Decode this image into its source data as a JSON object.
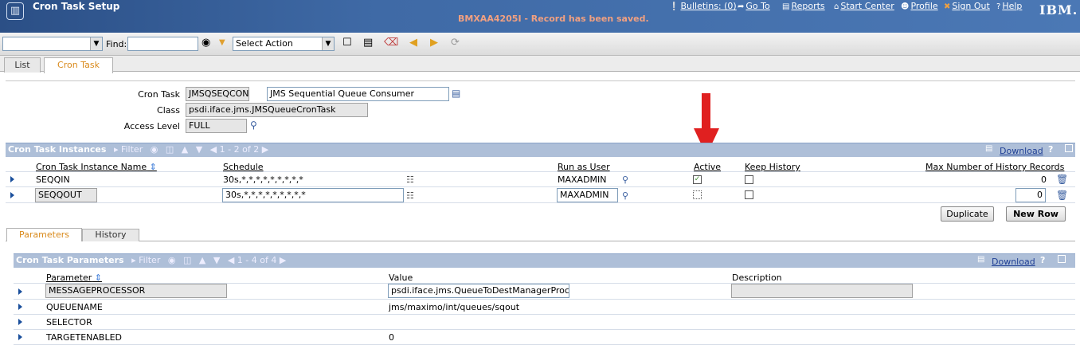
{
  "header": {
    "app_title": "Cron Task Setup",
    "message": "BMXAA4205I - Record has been saved.",
    "links": {
      "bulletins": "Bulletins: (0)",
      "goto": "Go To",
      "reports": "Reports",
      "start_center": "Start Center",
      "profile": "Profile",
      "sign_out": "Sign Out",
      "help": "Help"
    },
    "brand": "IBM."
  },
  "toolbar": {
    "find_label": "Find:",
    "find_value": "",
    "query_value": "",
    "action_value": "Select Action"
  },
  "tabs": {
    "list": "List",
    "cron_task": "Cron Task"
  },
  "form": {
    "cron_task_label": "Cron Task",
    "cron_task_value": "JMSQSEQCONS",
    "description_value": "JMS Sequential Queue Consumer",
    "class_label": "Class",
    "class_value": "psdi.iface.jms.JMSQueueCronTask",
    "access_label": "Access Level",
    "access_value": "FULL"
  },
  "instances": {
    "title": "Cron Task Instances",
    "filter": "Filter",
    "count": "1 - 2 of 2",
    "download": "Download",
    "help": "?",
    "columns": {
      "name": "Cron Task Instance Name",
      "schedule": "Schedule",
      "run_as": "Run as User",
      "active": "Active",
      "keep_history": "Keep History",
      "max_history": "Max Number of History Records"
    },
    "rows": [
      {
        "name": "SEQQIN",
        "schedule": "30s,*,*,*,*,*,*,*,*,*",
        "run_as": "MAXADMIN",
        "active": "true",
        "keep_history": "false",
        "max_history": "0"
      },
      {
        "name": "SEQQOUT",
        "schedule": "30s,*,*,*,*,*,*,*,*,*",
        "run_as": "MAXADMIN",
        "active": "false",
        "keep_history": "false",
        "max_history": "0"
      }
    ],
    "duplicate_button": "Duplicate",
    "new_row_button": "New Row"
  },
  "subtabs": {
    "parameters": "Parameters",
    "history": "History"
  },
  "parameters": {
    "title": "Cron Task Parameters",
    "filter": "Filter",
    "count": "1 - 4 of 4",
    "download": "Download",
    "help": "?",
    "columns": {
      "parameter": "Parameter",
      "value": "Value",
      "description": "Description"
    },
    "rows": [
      {
        "parameter": "MESSAGEPROCESSOR",
        "value": "psdi.iface.jms.QueueToDestManagerProcessor",
        "description": ""
      },
      {
        "parameter": "QUEUENAME",
        "value": "jms/maximo/int/queues/sqout",
        "description": ""
      },
      {
        "parameter": "SELECTOR",
        "value": "",
        "description": ""
      },
      {
        "parameter": "TARGETENABLED",
        "value": "0",
        "description": ""
      }
    ]
  },
  "colors": {
    "header_blue": "#3f6aa6",
    "section_bar": "#aebfd8",
    "message_orange": "#f1a081",
    "arrow_red": "#e02020",
    "active_tab": "#d98a1c"
  },
  "icons": [
    "app-logo-icon",
    "binoculars-icon",
    "new-record-icon",
    "save-icon",
    "clear-icon",
    "previous-icon",
    "next-icon",
    "refresh-icon",
    "lookup-icon",
    "trash-icon",
    "detail-menu-icon",
    "calendar-icon",
    "sort-icon",
    "down-arrow-indicator"
  ]
}
